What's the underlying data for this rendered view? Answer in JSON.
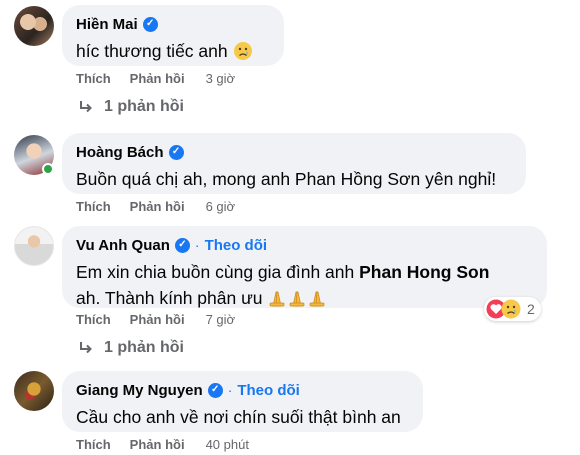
{
  "actions": {
    "like": "Thích",
    "reply": "Phản hồi"
  },
  "comments": [
    {
      "name": "Hiền Mai",
      "text": "híc thương tiếc anh",
      "time": "3 giờ",
      "replies_label": "1 phản hồi"
    },
    {
      "name": "Hoàng Bách",
      "text": "Buồn quá chị ah, mong anh Phan Hồng Sơn yên nghỉ!",
      "time": "6 giờ"
    },
    {
      "name": "Vu Anh Quan",
      "follow": "Theo dõi",
      "text_prefix": "Em xin chia buồn cùng gia đình anh ",
      "text_bold": "Phan Hong Son",
      "text_line2": "ah. Thành kính phân ưu",
      "time": "7 giờ",
      "reaction_count": "2",
      "replies_label": "1 phản hồi"
    },
    {
      "name": "Giang My Nguyen",
      "follow": "Theo dõi",
      "text": "Cầu cho anh về nơi chín suối thật bình an",
      "time": "40 phút"
    }
  ],
  "icons": {
    "verified": "verified-badge-icon",
    "sad": "sad-emoji-icon",
    "pray": "folded-hands-icon",
    "love": "love-reaction-icon",
    "reply_arrow": "reply-arrow-icon"
  },
  "colors": {
    "bubble": "#f0f2f5",
    "blue": "#1877f2",
    "muted": "#65676b",
    "online": "#31a24c"
  }
}
